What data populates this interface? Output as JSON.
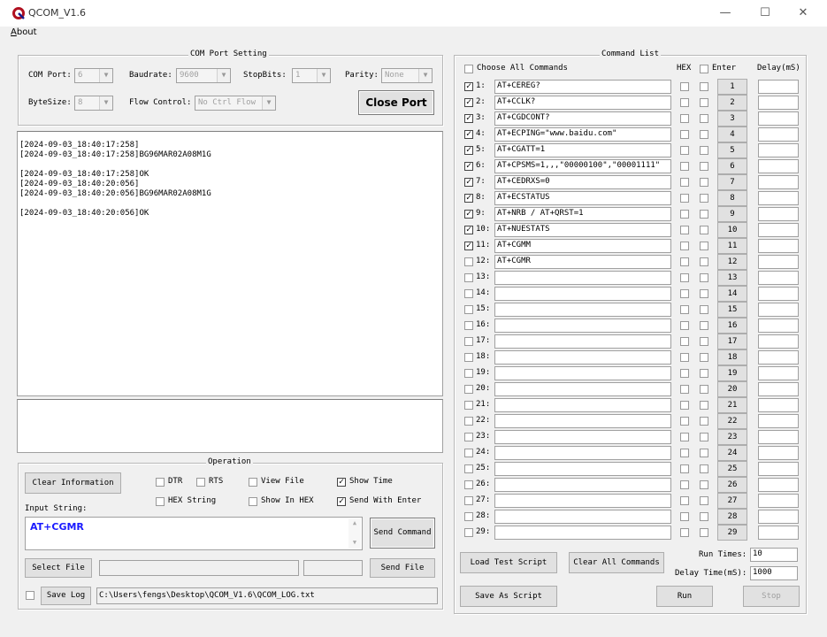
{
  "window": {
    "title": "QCOM_V1.6",
    "minimize": "—",
    "maximize": "☐",
    "close": "✕",
    "icon": "qcom-logo-icon"
  },
  "menu": [
    "About"
  ],
  "com_port": {
    "legend": "COM Port Setting",
    "port_label": "COM Port:",
    "port_value": "6",
    "baud_label": "Baudrate:",
    "baud_value": "9600",
    "stopbits_label": "StopBits:",
    "stopbits_value": "1",
    "parity_label": "Parity:",
    "parity_value": "None",
    "bytesize_label": "ByteSize:",
    "bytesize_value": "8",
    "flow_label": "Flow Control:",
    "flow_value": "No Ctrl Flow",
    "close_port": "Close Port"
  },
  "log": [
    "[2024-09-03_18:40:17:258]",
    "[2024-09-03_18:40:17:258]BG96MAR02A08M1G",
    "",
    "[2024-09-03_18:40:17:258]OK",
    "[2024-09-03_18:40:20:056]",
    "[2024-09-03_18:40:20:056]BG96MAR02A08M1G",
    "",
    "[2024-09-03_18:40:20:056]OK"
  ],
  "operation": {
    "legend": "Operation",
    "clear_info": "Clear Information",
    "dtr": "DTR",
    "rts": "RTS",
    "view_file": "View File",
    "show_time": "Show Time",
    "hex_string": "HEX String",
    "show_in_hex": "Show In HEX",
    "send_with_enter": "Send With Enter",
    "input_label": "Input String:",
    "input_value": "AT+CGMR",
    "send_command": "Send Command",
    "select_file": "Select File",
    "send_file": "Send File",
    "save_log": "Save Log",
    "log_path": "C:\\Users\\fengs\\Desktop\\QCOM_V1.6\\QCOM_LOG.txt",
    "input_color": "#1a1aff"
  },
  "command_list": {
    "legend": "Command List",
    "choose_all": "Choose All Commands",
    "hex_header": "HEX",
    "enter_header": "Enter",
    "delay_header": "Delay(mS)",
    "rows": [
      {
        "num": "1:",
        "cmd": "AT+CEREG?",
        "checked": true,
        "btn": "1"
      },
      {
        "num": "2:",
        "cmd": "AT+CCLK?",
        "checked": true,
        "btn": "2"
      },
      {
        "num": "3:",
        "cmd": "AT+CGDCONT?",
        "checked": true,
        "btn": "3"
      },
      {
        "num": "4:",
        "cmd": "AT+ECPING=\"www.baidu.com\"",
        "checked": true,
        "btn": "4"
      },
      {
        "num": "5:",
        "cmd": "AT+CGATT=1",
        "checked": true,
        "btn": "5"
      },
      {
        "num": "6:",
        "cmd": "AT+CPSMS=1,,,\"00000100\",\"00001111\"",
        "checked": true,
        "btn": "6"
      },
      {
        "num": "7:",
        "cmd": "AT+CEDRXS=0",
        "checked": true,
        "btn": "7"
      },
      {
        "num": "8:",
        "cmd": "AT+ECSTATUS",
        "checked": true,
        "btn": "8"
      },
      {
        "num": "9:",
        "cmd": "AT+NRB / AT+QRST=1",
        "checked": true,
        "btn": "9"
      },
      {
        "num": "10:",
        "cmd": "AT+NUESTATS",
        "checked": true,
        "btn": "10"
      },
      {
        "num": "11:",
        "cmd": "AT+CGMM",
        "checked": true,
        "btn": "11"
      },
      {
        "num": "12:",
        "cmd": "AT+CGMR",
        "checked": false,
        "btn": "12"
      },
      {
        "num": "13:",
        "cmd": "",
        "checked": false,
        "btn": "13"
      },
      {
        "num": "14:",
        "cmd": "",
        "checked": false,
        "btn": "14"
      },
      {
        "num": "15:",
        "cmd": "",
        "checked": false,
        "btn": "15"
      },
      {
        "num": "16:",
        "cmd": "",
        "checked": false,
        "btn": "16"
      },
      {
        "num": "17:",
        "cmd": "",
        "checked": false,
        "btn": "17"
      },
      {
        "num": "18:",
        "cmd": "",
        "checked": false,
        "btn": "18"
      },
      {
        "num": "19:",
        "cmd": "",
        "checked": false,
        "btn": "19"
      },
      {
        "num": "20:",
        "cmd": "",
        "checked": false,
        "btn": "20"
      },
      {
        "num": "21:",
        "cmd": "",
        "checked": false,
        "btn": "21"
      },
      {
        "num": "22:",
        "cmd": "",
        "checked": false,
        "btn": "22"
      },
      {
        "num": "23:",
        "cmd": "",
        "checked": false,
        "btn": "23"
      },
      {
        "num": "24:",
        "cmd": "",
        "checked": false,
        "btn": "24"
      },
      {
        "num": "25:",
        "cmd": "",
        "checked": false,
        "btn": "25"
      },
      {
        "num": "26:",
        "cmd": "",
        "checked": false,
        "btn": "26"
      },
      {
        "num": "27:",
        "cmd": "",
        "checked": false,
        "btn": "27"
      },
      {
        "num": "28:",
        "cmd": "",
        "checked": false,
        "btn": "28"
      },
      {
        "num": "29:",
        "cmd": "",
        "checked": false,
        "btn": "29"
      }
    ],
    "load_script": "Load Test Script",
    "clear_all": "Clear All Commands",
    "save_script": "Save As Script",
    "run_times_label": "Run Times:",
    "run_times_value": "10",
    "delay_time_label": "Delay Time(mS):",
    "delay_time_value": "1000",
    "run": "Run",
    "stop": "Stop"
  }
}
